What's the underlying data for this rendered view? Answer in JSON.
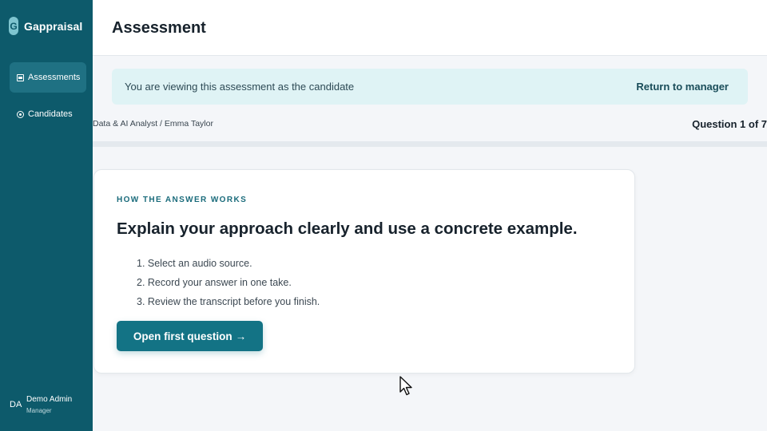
{
  "brand": {
    "logo_letter": "G",
    "name": "Gappraisal"
  },
  "sidebar": {
    "items": [
      {
        "label": "Assessments",
        "icon": "document-icon",
        "active": true
      },
      {
        "label": "Candidates",
        "icon": "people-icon",
        "active": false
      }
    ]
  },
  "user": {
    "initials": "DA",
    "name": "Demo Admin",
    "role": "Manager"
  },
  "header": {
    "title": "Assessment"
  },
  "banner": {
    "text": "You are viewing this assessment as the candidate",
    "link": "Return to manager"
  },
  "breadcrumb": "Data & AI Analyst / Emma Taylor",
  "progress": {
    "label": "Question 1 of 7",
    "current": 1,
    "total": 7
  },
  "card": {
    "eyebrow": "HOW THE ANSWER WORKS",
    "title": "Explain your approach clearly and use a concrete example.",
    "steps": [
      "1. Select an audio source.",
      "2. Record your answer in one take.",
      "3. Review the transcript before you finish."
    ],
    "cta_label": "Open first question",
    "cta_arrow": "→"
  },
  "colors": {
    "sidebar": "#0d5a6b",
    "sidebar_active": "#1f7183",
    "accent": "#137385",
    "banner_bg": "#dff3f5"
  }
}
